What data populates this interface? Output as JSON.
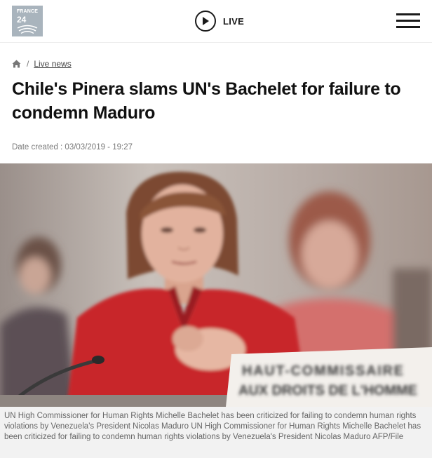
{
  "header": {
    "logo_line1": "FRANCE",
    "logo_line2": "24",
    "live_label": "LIVE"
  },
  "breadcrumb": {
    "home_icon": "home-icon",
    "separator": "/",
    "section": "Live news"
  },
  "article": {
    "title": "Chile's Pinera slams UN's Bachelet for failure to condemn Maduro",
    "date": "Date created : 03/03/2019 - 19:27",
    "image_sign_line1": "HAUT-COMMISSAIRE",
    "image_sign_line2": "AUX DROITS DE L'HOMME",
    "caption": "UN High Commissioner for Human Rights Michelle Bachelet has been criticized for failing to condemn human rights violations by Venezuela's President Nicolas Maduro UN High Commissioner for Human Rights Michelle Bachelet has been criticized for failing to condemn human rights violations by Venezuela's President Nicolas Maduro AFP/File"
  },
  "colors": {
    "logo_bg": "#a9b4bd",
    "jacket_red": "#c8282a",
    "caption_bg": "#f2f2f2"
  }
}
